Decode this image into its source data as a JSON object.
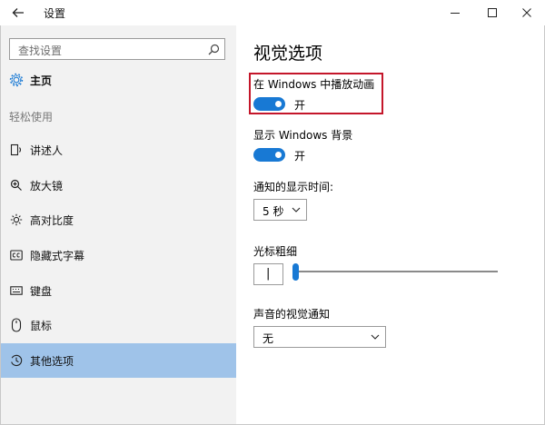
{
  "window": {
    "title": "设置",
    "back_icon": "arrow-left-icon",
    "controls": [
      "minimize-icon",
      "maximize-icon",
      "close-icon"
    ]
  },
  "search": {
    "placeholder": "查找设置",
    "icon": "search-icon"
  },
  "sidebar": {
    "home": {
      "label": "主页",
      "icon": "gear-icon"
    },
    "section": "轻松使用",
    "items": [
      {
        "label": "讲述人",
        "icon": "narrator-icon"
      },
      {
        "label": "放大镜",
        "icon": "magnifier-icon"
      },
      {
        "label": "高对比度",
        "icon": "brightness-icon"
      },
      {
        "label": "隐藏式字幕",
        "icon": "closed-caption-icon"
      },
      {
        "label": "键盘",
        "icon": "keyboard-icon"
      },
      {
        "label": "鼠标",
        "icon": "mouse-icon"
      },
      {
        "label": "其他选项",
        "icon": "clock-icon",
        "selected": true
      }
    ]
  },
  "main": {
    "title": "视觉选项",
    "animations": {
      "label": "在 Windows 中播放动画",
      "state": "开",
      "on": true
    },
    "background": {
      "label": "显示 Windows 背景",
      "state": "开",
      "on": true
    },
    "notification": {
      "label": "通知的显示时间:",
      "value": "5 秒"
    },
    "cursor": {
      "label": "光标粗细",
      "preview": "|",
      "level": 0.01
    },
    "sound": {
      "label": "声音的视觉通知",
      "value": "无"
    }
  },
  "colors": {
    "accent": "#1879d4",
    "selected_nav": "#9fc3e9",
    "highlight_box": "#c4162a",
    "sidebar_bg": "#f2f2f2"
  }
}
